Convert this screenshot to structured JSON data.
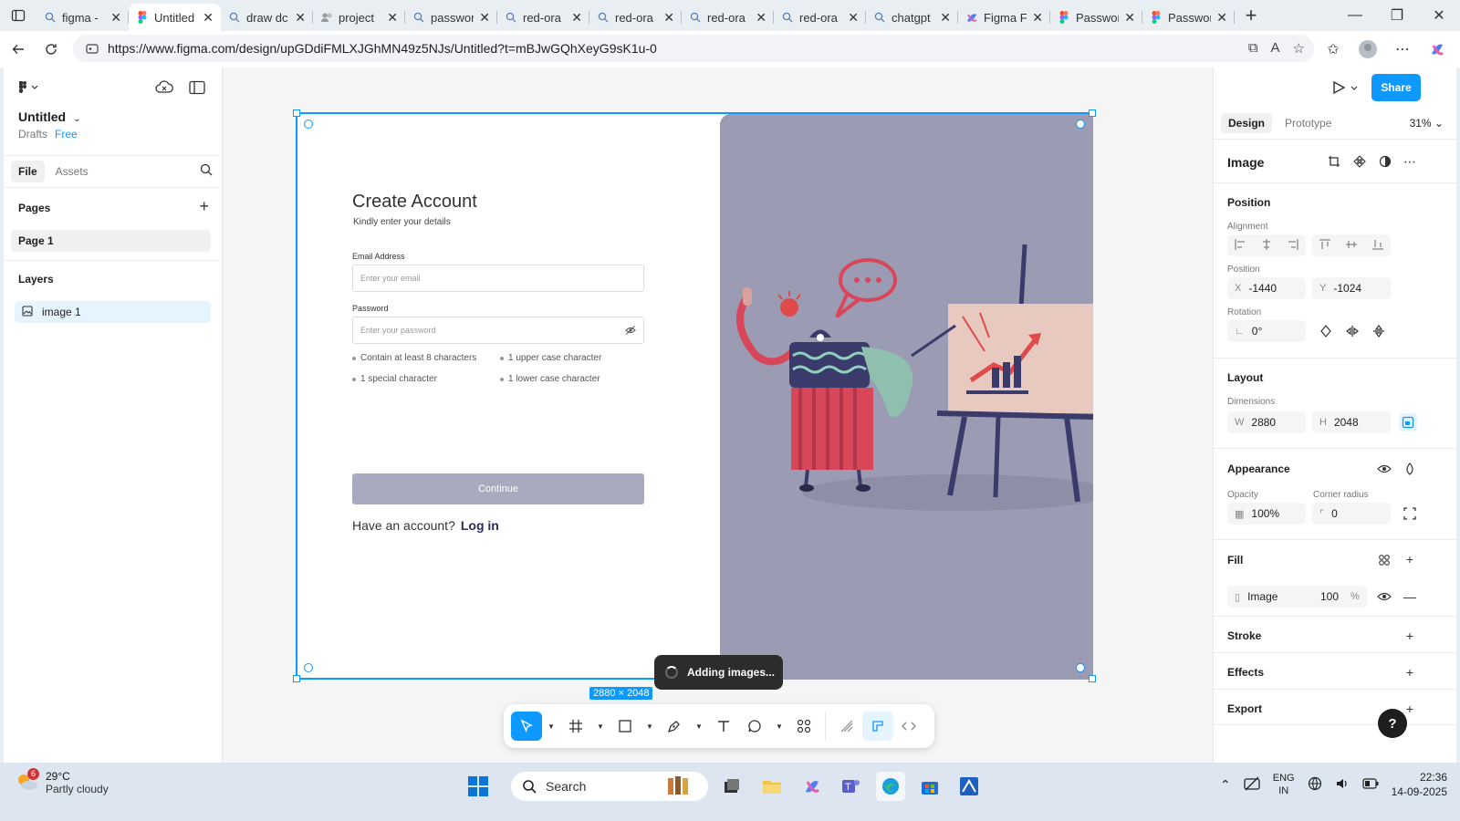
{
  "browser": {
    "tabs": [
      {
        "label": "figma -",
        "icon": "search-icon"
      },
      {
        "label": "Untitled",
        "icon": "figma-icon",
        "active": true
      },
      {
        "label": "draw dc",
        "icon": "search-icon"
      },
      {
        "label": "project",
        "icon": "people-icon"
      },
      {
        "label": "passwor",
        "icon": "search-icon"
      },
      {
        "label": "red-ora",
        "icon": "search-icon"
      },
      {
        "label": "red-ora",
        "icon": "search-icon"
      },
      {
        "label": "red-ora",
        "icon": "search-icon"
      },
      {
        "label": "red-ora",
        "icon": "search-icon"
      },
      {
        "label": "chatgpt",
        "icon": "search-icon"
      },
      {
        "label": "Figma F",
        "icon": "copilot-icon"
      },
      {
        "label": "Passwor",
        "icon": "figma-icon"
      },
      {
        "label": "Passwor",
        "icon": "figma-icon"
      }
    ],
    "url": "https://www.figma.com/design/upGDdiFMLXJGhMN49z5NJs/Untitled?t=mBJwGQhXeyG9sK1u-0"
  },
  "left_panel": {
    "file_title": "Untitled",
    "drafts": "Drafts",
    "plan": "Free",
    "tabs": [
      "File",
      "Assets"
    ],
    "pages_heading": "Pages",
    "pages": [
      "Page 1"
    ],
    "layers_heading": "Layers",
    "layers": [
      "image 1"
    ]
  },
  "canvas": {
    "form": {
      "title": "Create Account",
      "subtitle": "Kindly enter your details",
      "email_label": "Email Address",
      "email_placeholder": "Enter your email",
      "password_label": "Password",
      "password_placeholder": "Enter your password",
      "rules": [
        "Contain at least 8 characters",
        "1 upper case character",
        "1 special character",
        "1 lower case character"
      ],
      "continue_label": "Continue",
      "have_account": "Have an account?",
      "login_label": "Log in"
    },
    "dimensions_badge": "2880 × 2048",
    "toast": "Adding images...",
    "colors": {
      "selection": "#0d99ff",
      "illustration_bg": "#9b9bb3",
      "button": "#aaaabf"
    }
  },
  "right_panel": {
    "share_label": "Share",
    "tabs": [
      "Design",
      "Prototype"
    ],
    "zoom": "31%",
    "layer_type": "Image",
    "position_heading": "Position",
    "alignment_label": "Alignment",
    "position_label": "Position",
    "x_key": "X",
    "x_value": "-1440",
    "y_key": "Y",
    "y_value": "-1024",
    "rotation_label": "Rotation",
    "rotation_value": "0°",
    "layout_heading": "Layout",
    "dimensions_label": "Dimensions",
    "w_key": "W",
    "w_value": "2880",
    "h_key": "H",
    "h_value": "2048",
    "appearance_heading": "Appearance",
    "opacity_label": "Opacity",
    "opacity_value": "100%",
    "corner_label": "Corner radius",
    "corner_value": "0",
    "fill_heading": "Fill",
    "fill_type": "Image",
    "fill_opacity": "100",
    "fill_pct": "%",
    "stroke_heading": "Stroke",
    "effects_heading": "Effects",
    "export_heading": "Export",
    "help": "?"
  },
  "taskbar": {
    "weather_badge": "6",
    "temperature": "29°C",
    "weather": "Partly cloudy",
    "search_placeholder": "Search",
    "lang_top": "ENG",
    "lang_bottom": "IN",
    "time": "22:36",
    "date": "14-09-2025"
  }
}
